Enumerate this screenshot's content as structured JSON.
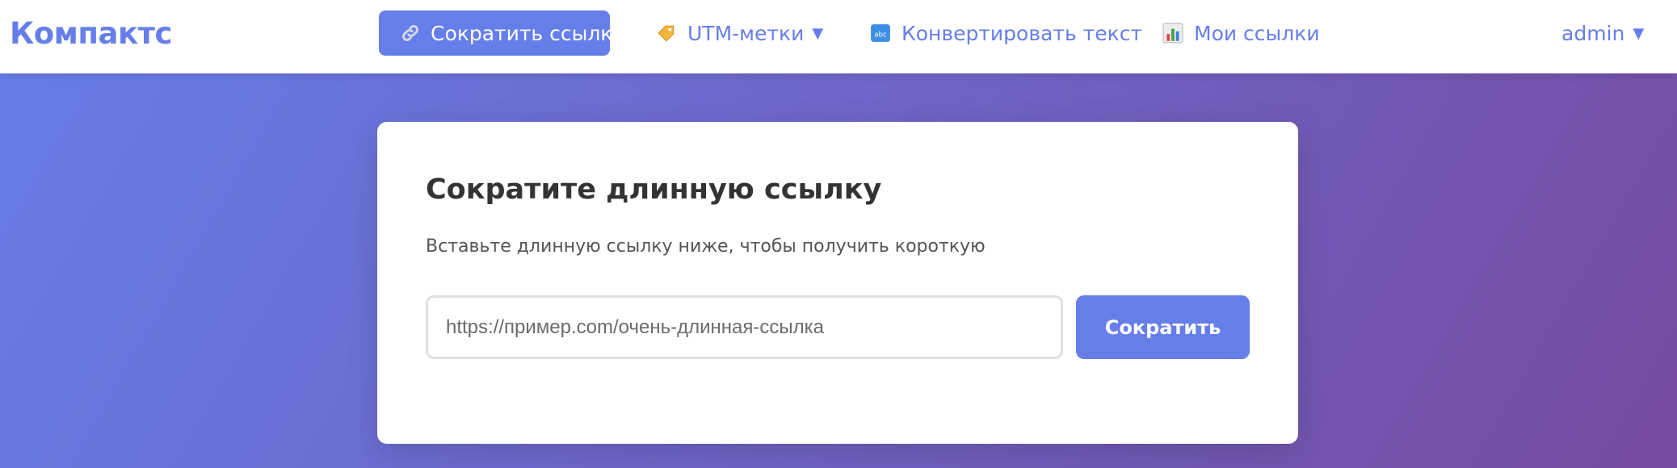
{
  "brand": "Компактс",
  "nav": {
    "shorten_label": "Сократить ссылку",
    "utm_label": "UTM-метки",
    "convert_label": "Конвертировать текст",
    "links_label": "Мои ссылки",
    "user_label": "admin",
    "caret": "▼",
    "icons": {
      "shorten": "link-icon",
      "utm": "tag-icon",
      "convert": "abc-icon",
      "links": "bar-chart-icon"
    }
  },
  "card": {
    "title": "Сократите длинную ссылку",
    "subtitle": "Вставьте длинную ссылку ниже, чтобы получить короткую",
    "input_value": "",
    "input_placeholder": "https://пример.com/очень-длинная-ссылка",
    "submit_label": "Сократить"
  },
  "colors": {
    "accent": "#667eea",
    "gradient_start": "#667eea",
    "gradient_end": "#764ba2",
    "title_text": "#333333"
  }
}
